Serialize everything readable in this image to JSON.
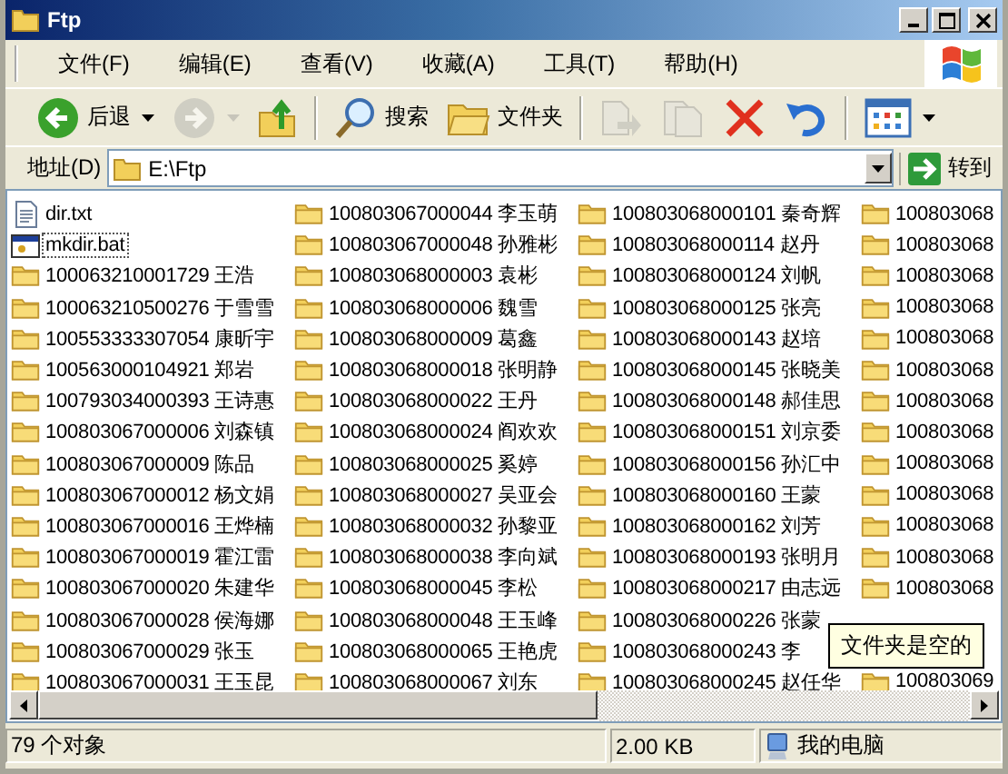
{
  "window": {
    "title": "Ftp"
  },
  "menu": [
    "文件(F)",
    "编辑(E)",
    "查看(V)",
    "收藏(A)",
    "工具(T)",
    "帮助(H)"
  ],
  "toolbar": [
    {
      "kind": "back",
      "label": "后退",
      "disabled": false,
      "dropdown": true
    },
    {
      "kind": "forward",
      "disabled": true,
      "dropdown": true
    },
    {
      "kind": "up",
      "disabled": false,
      "dropdown": false
    },
    {
      "kind": "search",
      "label": "搜索",
      "disabled": false,
      "dropdown": false
    },
    {
      "kind": "folders",
      "label": "文件夹",
      "disabled": false,
      "dropdown": false
    },
    {
      "kind": "move",
      "disabled": true,
      "dropdown": false
    },
    {
      "kind": "copy",
      "disabled": true,
      "dropdown": false
    },
    {
      "kind": "delete",
      "disabled": false,
      "dropdown": false
    },
    {
      "kind": "undo",
      "disabled": false,
      "dropdown": false
    },
    {
      "kind": "views",
      "disabled": false,
      "dropdown": true
    }
  ],
  "address": {
    "label": "地址(D)",
    "value": "E:\\Ftp",
    "go": "转到"
  },
  "files": [
    {
      "name": "dir.txt",
      "kind": "text",
      "focused": false
    },
    {
      "name": "mkdir.bat",
      "kind": "batch",
      "focused": true
    }
  ],
  "folders": [
    {
      "name": "100063210001729 王浩"
    },
    {
      "name": "100063210500276 于雪雪"
    },
    {
      "name": "100553333307054 康昕宇"
    },
    {
      "name": "100563000104921 郑岩"
    },
    {
      "name": "100793034000393 王诗惠"
    },
    {
      "name": "100803067000006 刘森镇"
    },
    {
      "name": "100803067000009 陈品"
    },
    {
      "name": "100803067000012 杨文娟"
    },
    {
      "name": "100803067000016 王烨楠"
    },
    {
      "name": "100803067000019 霍江雷"
    },
    {
      "name": "100803067000020 朱建华"
    },
    {
      "name": "100803067000028 侯海娜"
    },
    {
      "name": "100803067000029 张玉"
    },
    {
      "name": "100803067000031 王玉昆"
    },
    {
      "name": "100803067000044 李玉萌"
    },
    {
      "name": "100803067000048 孙雅彬"
    },
    {
      "name": "100803068000003 袁彬"
    },
    {
      "name": "100803068000006 魏雪"
    },
    {
      "name": "100803068000009 葛鑫"
    },
    {
      "name": "100803068000018 张明静"
    },
    {
      "name": "100803068000022 王丹"
    },
    {
      "name": "100803068000024 阎欢欢"
    },
    {
      "name": "100803068000025 奚婷"
    },
    {
      "name": "100803068000027 吴亚会"
    },
    {
      "name": "100803068000032 孙黎亚"
    },
    {
      "name": "100803068000038 李向斌"
    },
    {
      "name": "100803068000045 李松"
    },
    {
      "name": "100803068000048 王玉峰"
    },
    {
      "name": "100803068000065 王艳虎"
    },
    {
      "name": "100803068000067 刘东"
    },
    {
      "name": "100803068000101 秦奇辉"
    },
    {
      "name": "100803068000114 赵丹"
    },
    {
      "name": "100803068000124 刘帆"
    },
    {
      "name": "100803068000125 张亮"
    },
    {
      "name": "100803068000143 赵培"
    },
    {
      "name": "100803068000145 张晓美"
    },
    {
      "name": "100803068000148 郝佳思"
    },
    {
      "name": "100803068000151 刘京委"
    },
    {
      "name": "100803068000156 孙汇中"
    },
    {
      "name": "100803068000160 王蒙"
    },
    {
      "name": "100803068000162 刘芳"
    },
    {
      "name": "100803068000193 张明月"
    },
    {
      "name": "100803068000217 由志远"
    },
    {
      "name": "100803068000226 张蒙"
    },
    {
      "name": "100803068000243 李"
    },
    {
      "name": "100803068000245 赵任华"
    },
    {
      "name": "100803068"
    },
    {
      "name": "100803068"
    },
    {
      "name": "100803068"
    },
    {
      "name": "100803068"
    },
    {
      "name": "100803068"
    },
    {
      "name": "100803068"
    },
    {
      "name": "100803068"
    },
    {
      "name": "100803068"
    },
    {
      "name": "100803068"
    },
    {
      "name": "100803068"
    },
    {
      "name": "100803068"
    },
    {
      "name": "100803068"
    },
    {
      "name": "100803068"
    },
    {
      "name": "100803069"
    }
  ],
  "tooltip": "文件夹是空的",
  "status_bar": {
    "count": "79 个对象",
    "size": "2.00 KB",
    "location": "我的电脑"
  }
}
